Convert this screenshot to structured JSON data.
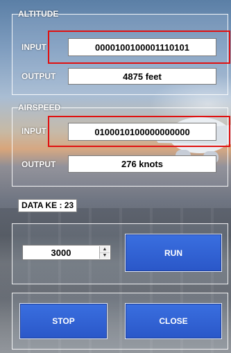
{
  "altitude": {
    "legend": "ALTITUDE",
    "input_label": "INPUT",
    "input_value": "0000100100001110101",
    "output_label": "OUTPUT",
    "output_value": "4875 feet"
  },
  "airspeed": {
    "legend": "AIRSPEED",
    "input_label": "INPUT",
    "input_value": "0100010100000000000",
    "output_label": "OUTPUT",
    "output_value": "276 knots"
  },
  "data_ke": "DATA  KE  : 23",
  "controls": {
    "interval_value": "3000",
    "run_label": "RUN",
    "stop_label": "STOP",
    "close_label": "CLOSE"
  },
  "colors": {
    "button": "#2f5fd6",
    "highlight": "#e01010"
  }
}
